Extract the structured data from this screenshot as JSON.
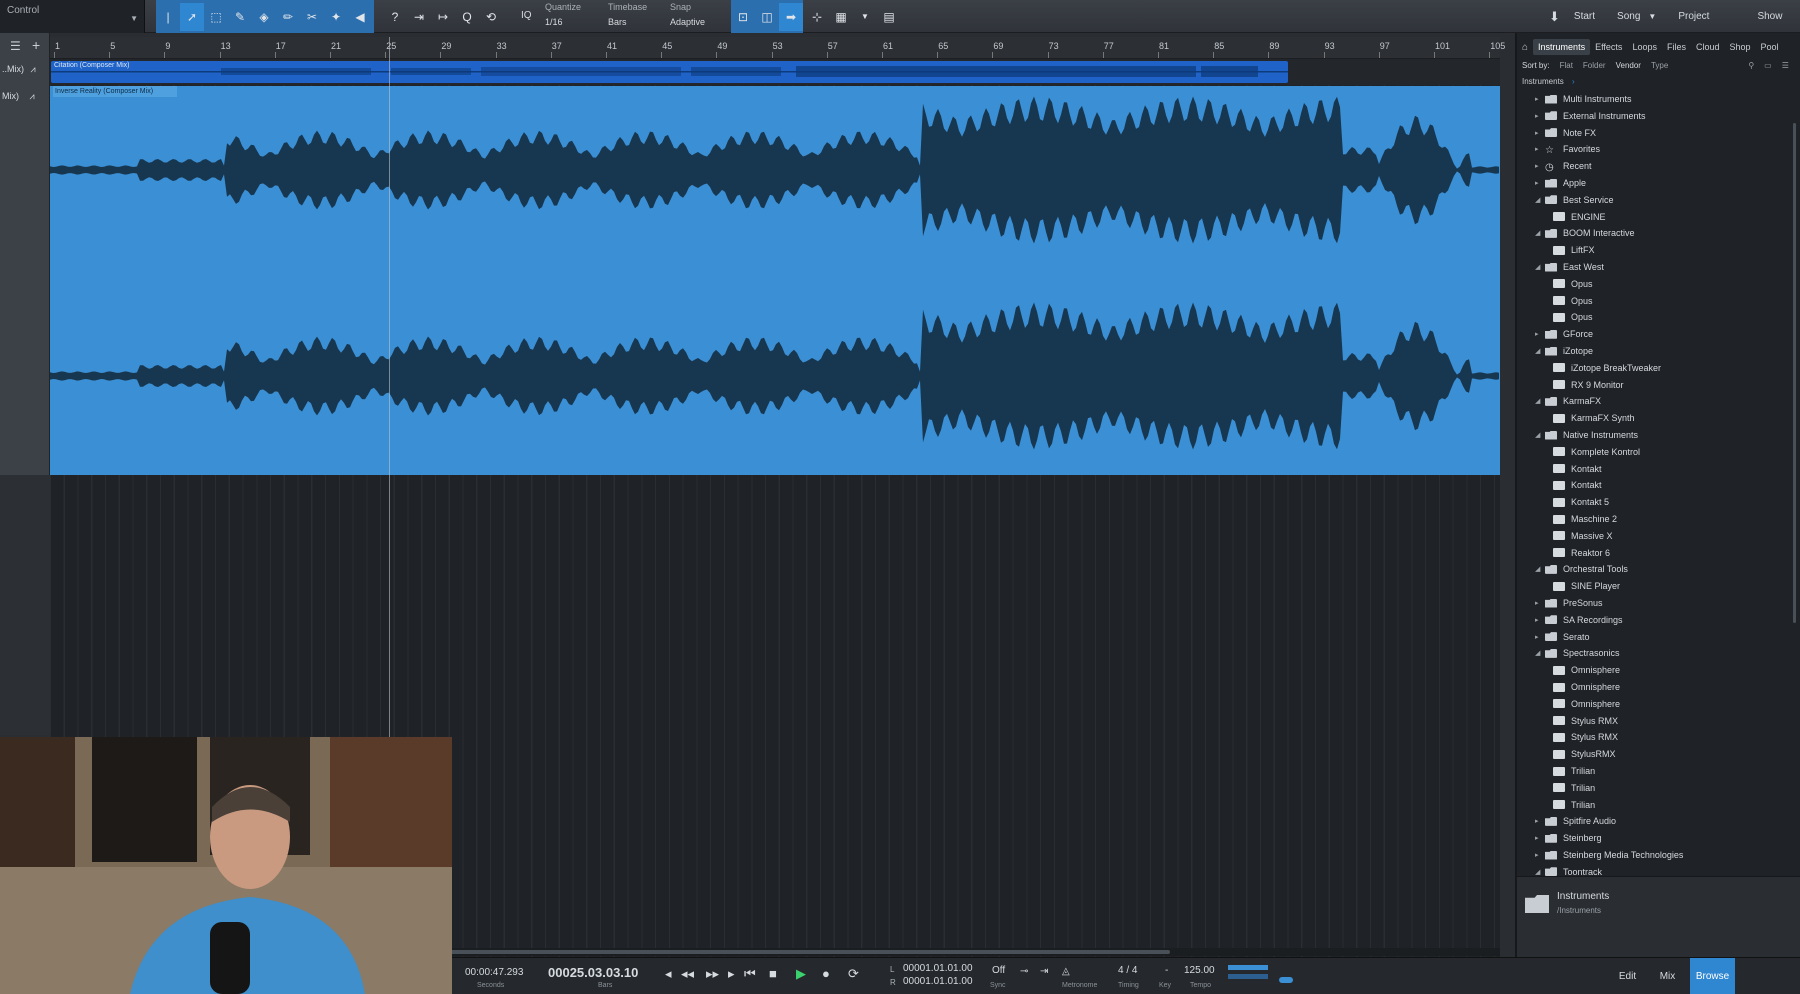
{
  "toolbar": {
    "control_label": "Control",
    "quantize_label": "Quantize",
    "quantize_value": "1/16",
    "timebase_label": "Timebase",
    "timebase_value": "Bars",
    "snap_label": "Snap",
    "snap_value": "Adaptive",
    "iq_label": "IQ",
    "nav": [
      "Start",
      "Song",
      "Project",
      "Show"
    ]
  },
  "tracks": {
    "track1_label": "..Mix)",
    "track2_label": "Mix)",
    "clip1_name": "Citation (Composer Mix)",
    "clip2_name": "Inverse Reality (Composer Mix)"
  },
  "ruler": [
    "1",
    "5",
    "9",
    "13",
    "17",
    "21",
    "25",
    "29",
    "33",
    "37",
    "41",
    "45",
    "49",
    "53",
    "57",
    "61",
    "65",
    "69",
    "73",
    "77",
    "81",
    "85",
    "89",
    "93",
    "97",
    "101",
    "105"
  ],
  "browser": {
    "tabs": [
      "Instruments",
      "Effects",
      "Loops",
      "Files",
      "Cloud",
      "Shop",
      "Pool"
    ],
    "sort_label": "Sort by:",
    "sort_options": [
      "Flat",
      "Folder",
      "Vendor",
      "Type"
    ],
    "breadcrumb": "Instruments",
    "items": [
      {
        "label": "Multi Instruments",
        "level": 0,
        "type": "folder",
        "open": false
      },
      {
        "label": "External Instruments",
        "level": 0,
        "type": "folder",
        "open": false
      },
      {
        "label": "Note FX",
        "level": 0,
        "type": "folder",
        "open": false
      },
      {
        "label": "Favorites",
        "level": 0,
        "type": "star",
        "open": false
      },
      {
        "label": "Recent",
        "level": 0,
        "type": "clock",
        "open": false
      },
      {
        "label": "Apple",
        "level": 0,
        "type": "folder",
        "open": false
      },
      {
        "label": "Best Service",
        "level": 0,
        "type": "folder",
        "open": true
      },
      {
        "label": "ENGINE",
        "level": 1,
        "type": "plugin"
      },
      {
        "label": "BOOM Interactive",
        "level": 0,
        "type": "folder",
        "open": true
      },
      {
        "label": "LiftFX",
        "level": 1,
        "type": "plugin"
      },
      {
        "label": "East West",
        "level": 0,
        "type": "folder",
        "open": true
      },
      {
        "label": "Opus",
        "level": 1,
        "type": "plugin"
      },
      {
        "label": "Opus",
        "level": 1,
        "type": "plugin"
      },
      {
        "label": "Opus",
        "level": 1,
        "type": "plugin"
      },
      {
        "label": "GForce",
        "level": 0,
        "type": "folder",
        "open": false
      },
      {
        "label": "iZotope",
        "level": 0,
        "type": "folder",
        "open": true
      },
      {
        "label": "iZotope BreakTweaker",
        "level": 1,
        "type": "plugin"
      },
      {
        "label": "RX 9 Monitor",
        "level": 1,
        "type": "plugin"
      },
      {
        "label": "KarmaFX",
        "level": 0,
        "type": "folder",
        "open": true
      },
      {
        "label": "KarmaFX Synth",
        "level": 1,
        "type": "plugin"
      },
      {
        "label": "Native Instruments",
        "level": 0,
        "type": "folder",
        "open": true
      },
      {
        "label": "Komplete Kontrol",
        "level": 1,
        "type": "plugin"
      },
      {
        "label": "Kontakt",
        "level": 1,
        "type": "plugin"
      },
      {
        "label": "Kontakt",
        "level": 1,
        "type": "plugin"
      },
      {
        "label": "Kontakt 5",
        "level": 1,
        "type": "plugin"
      },
      {
        "label": "Maschine 2",
        "level": 1,
        "type": "plugin"
      },
      {
        "label": "Massive X",
        "level": 1,
        "type": "plugin"
      },
      {
        "label": "Reaktor 6",
        "level": 1,
        "type": "plugin"
      },
      {
        "label": "Orchestral Tools",
        "level": 0,
        "type": "folder",
        "open": true
      },
      {
        "label": "SINE Player",
        "level": 1,
        "type": "plugin"
      },
      {
        "label": "PreSonus",
        "level": 0,
        "type": "folder",
        "open": false
      },
      {
        "label": "SA Recordings",
        "level": 0,
        "type": "folder",
        "open": false
      },
      {
        "label": "Serato",
        "level": 0,
        "type": "folder",
        "open": false
      },
      {
        "label": "Spectrasonics",
        "level": 0,
        "type": "folder",
        "open": true
      },
      {
        "label": "Omnisphere",
        "level": 1,
        "type": "plugin"
      },
      {
        "label": "Omnisphere",
        "level": 1,
        "type": "plugin"
      },
      {
        "label": "Omnisphere",
        "level": 1,
        "type": "plugin"
      },
      {
        "label": "Stylus RMX",
        "level": 1,
        "type": "plugin"
      },
      {
        "label": "Stylus RMX",
        "level": 1,
        "type": "plugin"
      },
      {
        "label": "StylusRMX",
        "level": 1,
        "type": "plugin"
      },
      {
        "label": "Trilian",
        "level": 1,
        "type": "plugin"
      },
      {
        "label": "Trilian",
        "level": 1,
        "type": "plugin"
      },
      {
        "label": "Trilian",
        "level": 1,
        "type": "plugin"
      },
      {
        "label": "Spitfire Audio",
        "level": 0,
        "type": "folder",
        "open": false
      },
      {
        "label": "Steinberg",
        "level": 0,
        "type": "folder",
        "open": false
      },
      {
        "label": "Steinberg Media Technologies",
        "level": 0,
        "type": "folder",
        "open": false
      },
      {
        "label": "Toontrack",
        "level": 0,
        "type": "folder",
        "open": true
      }
    ],
    "footer_title": "Instruments",
    "footer_path": "/Instruments"
  },
  "transport": {
    "time_seconds": "00:00:47.293",
    "seconds_label": "Seconds",
    "bars_position": "00025.03.03.10",
    "bars_label": "Bars",
    "loop_left": "00001.01.01.00",
    "loop_right": "00001.01.01.00",
    "loop_l": "L",
    "loop_r": "R",
    "sync_value": "Off",
    "sync_label": "Sync",
    "metronome_label": "Metronome",
    "timing_value": "4 / 4",
    "timing_label": "Timing",
    "key_value": "-",
    "key_label": "Key",
    "tempo_value": "125.00",
    "tempo_label": "Tempo",
    "right_buttons": [
      "Edit",
      "Mix",
      "Browse"
    ]
  },
  "colors": {
    "clip_blue": "#3b8fd4",
    "clip_dark_blue": "#1f63c9",
    "waveform": "#17364f",
    "accent": "#2f86d1"
  }
}
